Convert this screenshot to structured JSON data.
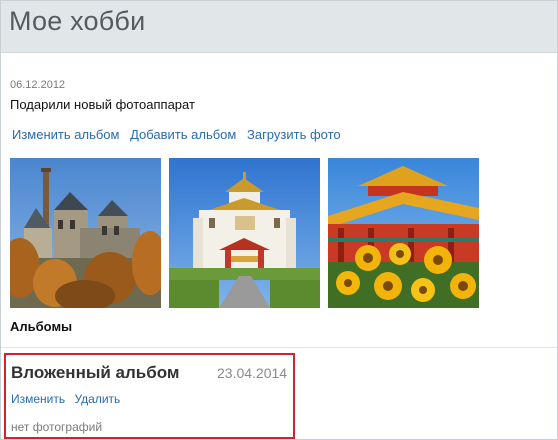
{
  "page": {
    "title": "Мое хобби"
  },
  "entry": {
    "date": "06.12.2012",
    "caption": "Подарили новый фотоаппарат",
    "actions": {
      "edit_album": "Изменить альбом",
      "add_album": "Добавить альбом",
      "upload_photo": "Загрузить фото"
    },
    "photos": [
      {
        "icon": "castle-photo",
        "colors": {
          "sky": "#5d95d6",
          "wall": "#8f8672",
          "tree": "#a8631e"
        }
      },
      {
        "icon": "temple-photo",
        "colors": {
          "sky": "#3f84db",
          "wall": "#f1eee5",
          "roof": "#c99a2c"
        }
      },
      {
        "icon": "pagoda-flowers-photo",
        "colors": {
          "sky": "#5a9fe6",
          "roof": "#e0a21c",
          "flower": "#f2b40a"
        }
      }
    ],
    "albums_label": "Альбомы"
  },
  "sub_album": {
    "title": "Вложенный альбом",
    "date": "23.04.2014",
    "edit": "Изменить",
    "delete": "Удалить",
    "empty_text": "нет фотографий",
    "highlight_color": "#d2232a"
  }
}
